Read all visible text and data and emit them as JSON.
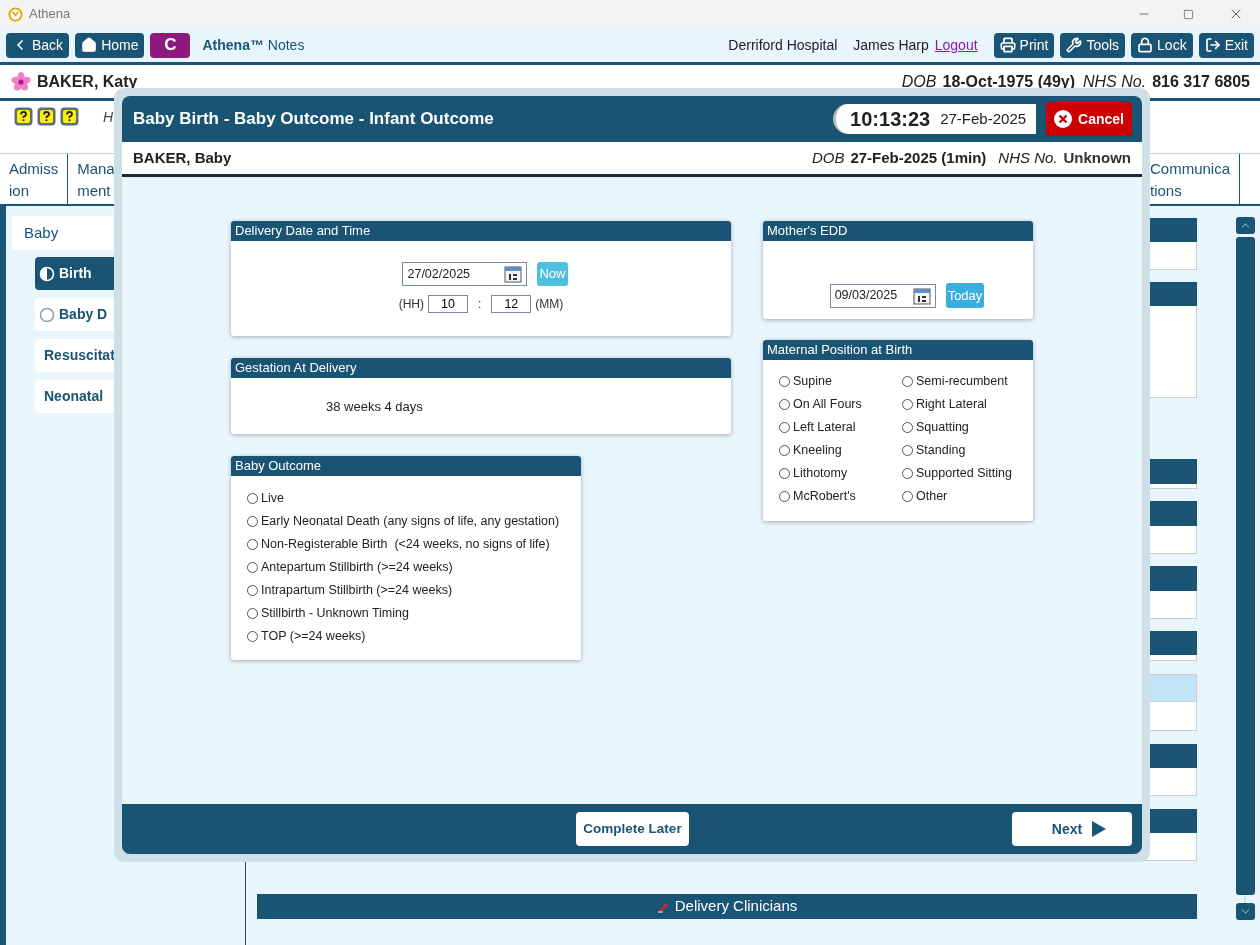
{
  "window": {
    "title": "Athena"
  },
  "toolbar": {
    "buttons_left": [
      {
        "kind": "back",
        "label": "Back"
      },
      {
        "kind": "home",
        "label": "Home"
      },
      {
        "kind": "letter",
        "label": "C"
      }
    ],
    "app_name": "Athena™",
    "app_suffix": "Notes",
    "hospital": "Derriford Hospital",
    "user": "James Harp",
    "logout": "Logout",
    "buttons_right": [
      {
        "kind": "print",
        "label": "Print"
      },
      {
        "kind": "tools",
        "label": "Tools"
      },
      {
        "kind": "lock",
        "label": "Lock"
      },
      {
        "kind": "exit",
        "label": "Exit"
      }
    ]
  },
  "patient": {
    "name": "BAKER, Katy",
    "dob_label": "DOB",
    "dob": "18-Oct-1975 (49y)",
    "nhs_label": "NHS No.",
    "nhs": "816 317 6805"
  },
  "alerts": {
    "text": "H"
  },
  "tabs": [
    {
      "lines": [
        "Admiss",
        "ion"
      ],
      "selected": false
    },
    {
      "lines": [
        "Mana",
        "ment"
      ],
      "selected": false
    },
    {
      "lines": [
        "Communica",
        "tions"
      ],
      "selected": false
    }
  ],
  "sidebar": {
    "title": "Baby",
    "items": [
      {
        "kind": "step",
        "label": "Birth",
        "selected": true,
        "started": true
      },
      {
        "kind": "step",
        "label": "Baby D",
        "selected": false,
        "started": false
      },
      {
        "kind": "plain",
        "label": "Resuscitat",
        "selected": false
      },
      {
        "kind": "plain",
        "label": "Neonatal",
        "selected": false
      }
    ]
  },
  "sections": [
    {
      "title": "Delivery Clinicians"
    }
  ],
  "modal": {
    "title": "Baby Birth - Baby Outcome - Infant Outcome",
    "time": "10:13:23",
    "date": "27-Feb-2025",
    "cancel": "Cancel",
    "baby": {
      "name": "BAKER, Baby",
      "dob_label": "DOB",
      "dob": "27-Feb-2025 (1min)",
      "nhs_label": "NHS No.",
      "nhs": "Unknown"
    },
    "delivery": {
      "title": "Delivery Date and Time",
      "date": "27/02/2025",
      "now": "Now",
      "hh_label": "(HH)",
      "hh": "10",
      "sep": ":",
      "mm": "12",
      "mm_label": "(MM)"
    },
    "gestation": {
      "title": "Gestation At Delivery",
      "value": "38 weeks 4 days"
    },
    "outcome": {
      "title": "Baby Outcome",
      "options": [
        {
          "label": "Live",
          "selected": false
        },
        {
          "label": "Early Neonatal Death (any signs of life, any gestation)",
          "selected": false
        },
        {
          "label": "Non-Registerable Birth  (<24 weeks, no signs of life)",
          "selected": false
        },
        {
          "label": "Antepartum Stillbirth (>=24 weeks)",
          "selected": false
        },
        {
          "label": "Intrapartum Stillbirth (>=24 weeks)",
          "selected": false
        },
        {
          "label": "Stillbirth - Unknown Timing",
          "selected": false
        },
        {
          "label": "TOP (>=24 weeks)",
          "selected": false
        }
      ]
    },
    "edd": {
      "title": "Mother's EDD",
      "date": "09/03/2025",
      "today": "Today"
    },
    "position": {
      "title": "Maternal Position at Birth",
      "options": [
        {
          "label": "Supine",
          "selected": false
        },
        {
          "label": "Semi-recumbent",
          "selected": false
        },
        {
          "label": "On All Fours",
          "selected": false
        },
        {
          "label": "Right Lateral",
          "selected": false
        },
        {
          "label": "Left Lateral",
          "selected": false
        },
        {
          "label": "Squatting",
          "selected": false
        },
        {
          "label": "Kneeling",
          "selected": false
        },
        {
          "label": "Standing",
          "selected": false
        },
        {
          "label": "Lithotomy",
          "selected": false
        },
        {
          "label": "Supported Sitting",
          "selected": false
        },
        {
          "label": "McRobert's",
          "selected": false
        },
        {
          "label": "Other",
          "selected": false
        }
      ]
    },
    "footer": {
      "complete_later": "Complete Later",
      "next": "Next"
    }
  }
}
